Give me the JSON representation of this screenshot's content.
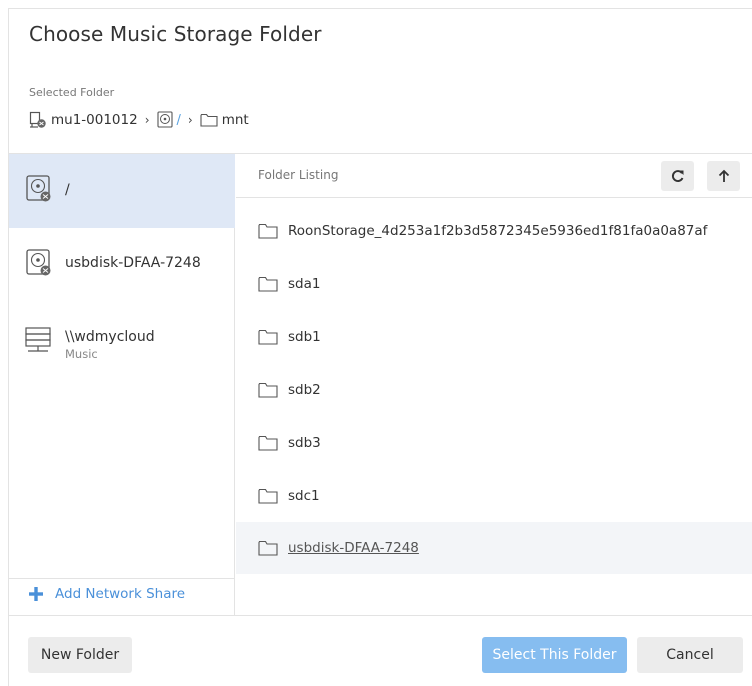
{
  "dialog": {
    "title": "Choose Music Storage Folder",
    "selected_label": "Selected Folder"
  },
  "breadcrumb": [
    {
      "label": "mu1-001012",
      "icon": "computer-icon"
    },
    {
      "label": "/",
      "icon": "disk-icon"
    },
    {
      "label": "mnt",
      "icon": "folder-icon"
    }
  ],
  "drives": [
    {
      "name": "/",
      "icon": "disk-icon",
      "selected": true
    },
    {
      "name": "usbdisk-DFAA-7248",
      "icon": "disk-icon",
      "selected": false
    },
    {
      "name": "\\\\wdmycloud",
      "sub": "Music",
      "icon": "network-share-icon",
      "selected": false
    }
  ],
  "add_share": "Add Network Share",
  "listing": {
    "header": "Folder Listing",
    "folders": [
      {
        "name": "RoonStorage_4d253a1f2b3d5872345e5936ed1f81fa0a0a87af"
      },
      {
        "name": "sda1"
      },
      {
        "name": "sdb1"
      },
      {
        "name": "sdb2"
      },
      {
        "name": "sdb3"
      },
      {
        "name": "sdc1"
      },
      {
        "name": "usbdisk-DFAA-7248",
        "hovered": true
      }
    ]
  },
  "buttons": {
    "new_folder": "New Folder",
    "select": "Select This Folder",
    "cancel": "Cancel"
  },
  "colors": {
    "accent": "#4a90d9",
    "selected_bg": "#dfe8f6",
    "primary_button": "#86bdf0"
  }
}
